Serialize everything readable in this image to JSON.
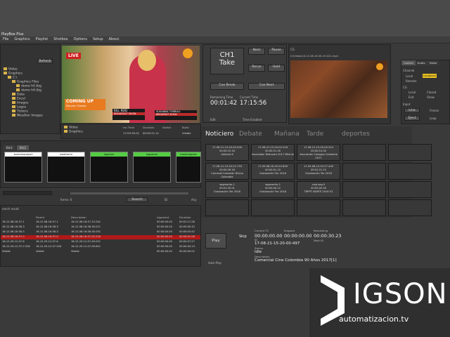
{
  "app": {
    "title": "PlayBox Plus"
  },
  "menu": [
    "File",
    "Graphics",
    "Playlist",
    "Shotbox",
    "Options",
    "Setup",
    "About"
  ],
  "browser": {
    "refresh_label": "Refresh",
    "tree": [
      "Video",
      "Graphics",
      "C:\\",
      "Graphics Files",
      "demo h5.tbg",
      "demo h4.tbg",
      "Data",
      "Excel",
      "Images",
      "Logos",
      "Tickers",
      "Weather Images"
    ]
  },
  "preview": {
    "live_badge": "LIVE",
    "coming_up": "COMING UP",
    "coming_up_sub": "Denver Cheats",
    "lower_third_name": "BILL REID",
    "lower_third_show": "BREAKFAST SHOW",
    "lower_third_name2": "SUSANNA TURBULL",
    "lower_third_show2": "BREAKFAST SHOW"
  },
  "take": {
    "channel_label": "CH1",
    "take_label": "Take",
    "next": "Next",
    "pause": "Pause",
    "cue_break": "Cue Break",
    "cue_next": "Cue Next",
    "rerun": "Rerun",
    "hold": "Hold",
    "remaining_label": "Remaining Time",
    "remaining_time": "00:01:42",
    "current_label": "Current Time",
    "current_time": "17:15:56",
    "edit": "Edit",
    "time_enabled": "Time Enabled"
  },
  "output": {
    "cg_label": "CG",
    "file": "D:\\Video\\16-12-08-16-36-19-021.mp4"
  },
  "controls": {
    "tabs": [
      "Control",
      "Audio",
      "Video"
    ],
    "channel_label": "Channel",
    "local": "Local",
    "loopback": "Loopback",
    "remote": "Remote",
    "cg_label": "CG",
    "cg_local": "Local",
    "closed": "Closed",
    "exit": "Exit",
    "show": "Show",
    "input_label": "Input",
    "line": "Line",
    "freeze": "Freeze",
    "eject": "Eject",
    "loop": "Loop"
  },
  "mid_left": {
    "folders": [
      "Video",
      "Graphics"
    ],
    "columns": [
      "Ins Time",
      "Duration",
      "Switch",
      "Build"
    ],
    "row": [
      "17:03:35.01",
      "00:00:21.11",
      "",
      "Visible"
    ]
  },
  "thumbs": {
    "tabs": [
      "Bin1",
      "Bin2"
    ],
    "items": [
      {
        "label": "businessreport",
        "color": "#ffffff"
      },
      {
        "label": "weatherm",
        "color": "#ffffff"
      },
      {
        "label": "logolive",
        "color": "#55cc44"
      },
      {
        "label": "logozone",
        "color": "#55cc44"
      },
      {
        "label": "breakingnew",
        "color": "#55cc44"
      }
    ]
  },
  "search": {
    "items_label": "Items: 6",
    "search_btn": "Search",
    "id_label": "ID",
    "any_label": "Any"
  },
  "results": {
    "title": "earch result",
    "columns": [
      "",
      "Parent",
      "Description",
      "Apparent",
      "Duration"
    ],
    "rows": [
      [
        "16-12-08-16-57-1",
        "16-12-08-16-57-1",
        "16-12-08-16-57-12-041",
        "00:00:00.00",
        "00:01:11.28"
      ],
      [
        "16-12-08-16-58-3",
        "16-12-08-16-58-3",
        "16-12-08-16-58-30-011",
        "00:00:00.00",
        "00:00:00.32"
      ],
      [
        "16-12-08-16-58-3",
        "16-12-08-16-58-3",
        "16-12-08-16-58-30-031",
        "00:00:00.00",
        "00:00:03.42"
      ],
      [
        "16-12-08-16-57-0",
        "16-12-08-16-57-0",
        "16-12-08-16-57-02-218",
        "00:00:00.00",
        "00:00:01.08"
      ],
      [
        "16-12-29-12-07-6",
        "16-12-29-12-07-6",
        "16-12-29-12-07-49-021",
        "00:00:00.00",
        "00:00:07.27"
      ],
      [
        "16-12-29-12-57-0 526",
        "16-12-29-12-07-526",
        "16-12-29-12-07-09-821",
        "00:00:00.00",
        "00:00:04.13"
      ],
      [
        "Visible",
        "Visible",
        "Visible",
        "00:00:00.00",
        "00:00:00.02"
      ]
    ]
  },
  "shotbox": {
    "tabs": [
      "Noticiero",
      "Debate",
      "Mañana",
      "Tarde",
      "deportes"
    ],
    "buttons": [
      "17-08-21-15-20-00-500\n00:00:15.16\nGallería 8",
      "17-08-21-15-20-02-516\n00:00:21.16\nAsociados Telenorte 2017 Milenio",
      "17-08-21-15-20-00-514\n00:00:10.00\nAsociación Colegios Colombia 2017",
      "17-08-21-15-20-02-793\n00:00:26.16\nCarnaval Camarón Divino Colombia",
      "17-09-08-16-20-55-859\n00:00:01.10\nGraduación Tec 2016",
      "17-09-08-14-25-57-405\n00:01:21.15\nGraduación Tec 2016",
      "segmento-1\n00:01:35.01\nGraduación Tec 2016",
      "segmento-2\n00:00:00.12\nGraduación Tec 2016",
      "cost-seg-5\n00:00:00.00\nTRPPT NORTE 2016 V2"
    ]
  },
  "playback": {
    "play": "Play",
    "skip": "Skip",
    "auto_play": "Auto Play",
    "current_tc_label": "Current TC",
    "current_tc": "00:00:00.00",
    "elapsed_label": "Elapsed",
    "elapsed": "00:00:00.00",
    "remaining_label": "Remaining",
    "remaining": "00:00:30.23",
    "id_label": "ID",
    "id": "17-08-21-15-20-00-497",
    "next_id_label": "Next ID",
    "status_label": "Status",
    "status": "Idle",
    "desc_label": "Description",
    "description": "Comercial Cine Colombia 90 Años 2017[1]"
  },
  "brand": {
    "name": "IGSON",
    "url": "automatizacion.tv"
  }
}
